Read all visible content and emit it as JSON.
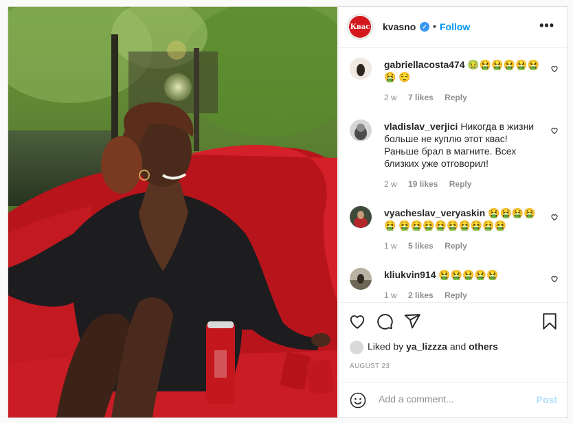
{
  "post": {
    "username": "kvasno",
    "logo_text": "Квас",
    "follow_label": "Follow",
    "more_label": "•••",
    "separator": "•"
  },
  "comments": [
    {
      "user": "gabriellacosta474",
      "text": "🤢🤮🤮🤮🤮🤮🤮 😌",
      "age": "2 w",
      "likes": "7 likes",
      "reply": "Reply"
    },
    {
      "user": "vladislav_verjici",
      "text": "Никогда в жизни больше не куплю этот квас! Раньше брал в магните. Всех близких уже отговорил!",
      "age": "2 w",
      "likes": "19 likes",
      "reply": "Reply"
    },
    {
      "user": "vyacheslav_veryaskin",
      "text": "🤮🤮🤮🤮🤮 🤮🤮🤮🤮🤮🤮🤮🤮🤮",
      "age": "1 w",
      "likes": "5 likes",
      "reply": "Reply"
    },
    {
      "user": "kliukvin914",
      "text": "🤮🤮🤮🤮🤮",
      "age": "1 w",
      "likes": "2 likes",
      "reply": "Reply"
    }
  ],
  "likes": {
    "prefix": "Liked by",
    "user": "ya_lizzza",
    "middle": "and",
    "suffix": "others"
  },
  "date": "AUGUST 23",
  "add_comment": {
    "placeholder": "Add a comment...",
    "post_label": "Post"
  },
  "icons": [
    "heart-icon",
    "comment-icon",
    "share-icon",
    "bookmark-icon",
    "emoji-icon",
    "verified-icon",
    "more-icon"
  ],
  "colors": {
    "follow": "#0095f6",
    "post_disabled": "#b2dffc",
    "brand_red": "#d3171d",
    "verified": "#3897f0"
  }
}
